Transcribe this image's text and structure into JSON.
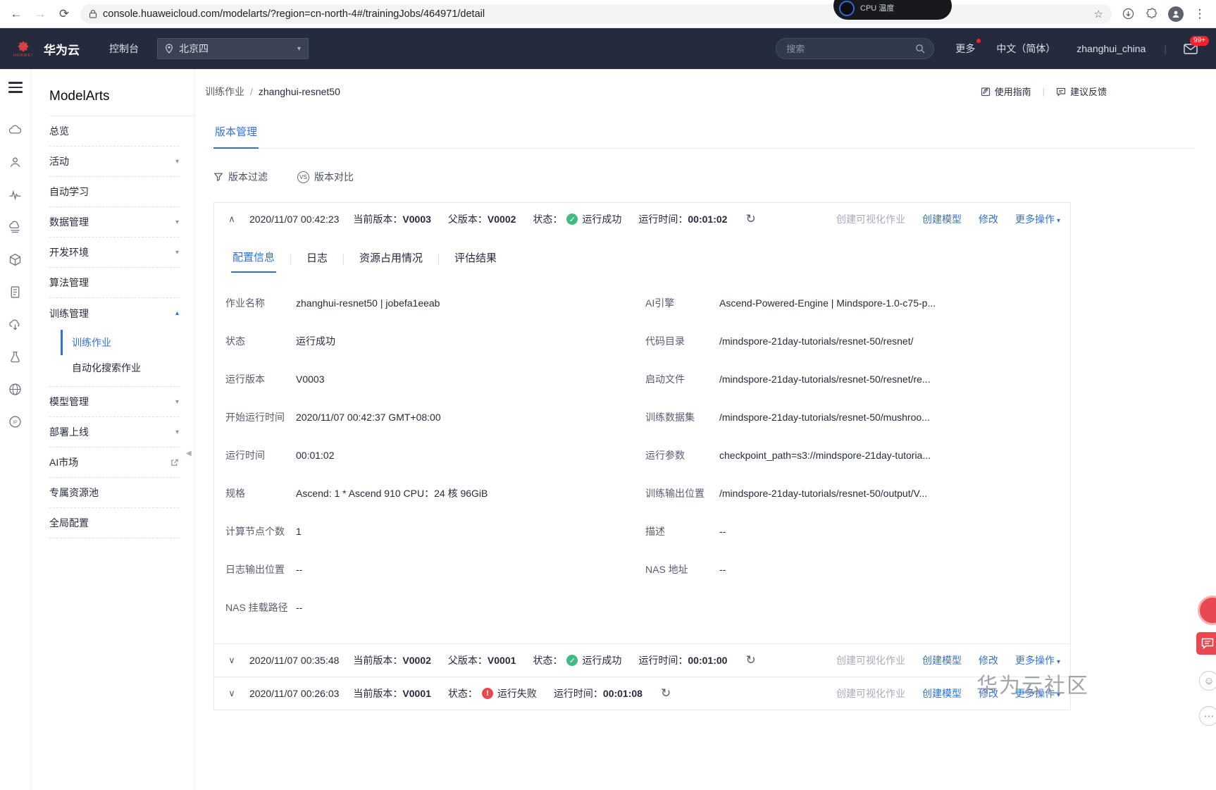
{
  "colors": {
    "accent": "#3370d4",
    "success": "#41ba83",
    "danger": "#e8484f",
    "navbar": "#232b3c"
  },
  "glyphs": {
    "back": "←",
    "forward": "→",
    "reload": "⟳",
    "star": "☆",
    "kebab": "⋮",
    "caret_down": "▾",
    "caret_up": "▴",
    "chevron_collapse": "∧",
    "chevron_expand": "∨",
    "refresh": "↻",
    "slash": "/",
    "pipe": "|",
    "success": "✓",
    "fail": "!",
    "smiley": "☺",
    "dots": "⋯",
    "sidebar_handle": "◀",
    "more_caret": "▾",
    "vs": "VS"
  },
  "browser": {
    "url": "console.huaweicloud.com/modelarts/?region=cn-north-4#/trainingJobs/464971/detail",
    "overlay_text": "CPU 温度"
  },
  "topnav": {
    "brand": "华为云",
    "logo_caption": "HUAWEI",
    "console": "控制台",
    "region": "北京四",
    "search_placeholder": "搜索",
    "more": "更多",
    "lang": "中文（简体）",
    "user": "zhanghui_china",
    "mail_badge": "99+"
  },
  "sidebar": {
    "title": "ModelArts",
    "items": [
      {
        "label": "总览"
      },
      {
        "label": "活动"
      },
      {
        "label": "自动学习"
      },
      {
        "label": "数据管理"
      },
      {
        "label": "开发环境"
      },
      {
        "label": "算法管理"
      },
      {
        "label": "训练管理",
        "children": [
          {
            "label": "训练作业"
          },
          {
            "label": "自动化搜索作业"
          }
        ]
      },
      {
        "label": "模型管理"
      },
      {
        "label": "部署上线"
      },
      {
        "label": "AI市场"
      },
      {
        "label": "专属资源池"
      },
      {
        "label": "全局配置"
      }
    ]
  },
  "page": {
    "breadcrumb_parent": "训练作业",
    "breadcrumb_current": "zhanghui-resnet50",
    "guide": "使用指南",
    "feedback": "建议反馈",
    "tab": "版本管理",
    "filter": "版本过滤",
    "compare": "版本对比"
  },
  "version_labels": {
    "current": "当前版本：",
    "parent": "父版本：",
    "status": "状态：",
    "runtime": "运行时间："
  },
  "actions": {
    "visual": "创建可视化作业",
    "create_model": "创建模型",
    "modify": "修改",
    "more": "更多操作"
  },
  "detail_tabs": [
    "配置信息",
    "日志",
    "资源占用情况",
    "评估结果"
  ],
  "versions": [
    {
      "time": "2020/11/07 00:42:23",
      "current": "V0003",
      "parent": "V0002",
      "status": "运行成功",
      "runtime": "00:01:02"
    },
    {
      "time": "2020/11/07 00:35:48",
      "current": "V0002",
      "parent": "V0001",
      "status": "运行成功",
      "runtime": "00:01:00"
    },
    {
      "time": "2020/11/07 00:26:03",
      "current": "V0001",
      "status": "运行失败",
      "runtime": "00:01:08"
    }
  ],
  "details": {
    "rows": [
      {
        "l_label": "作业名称",
        "l_value": "zhanghui-resnet50 | jobefa1eeab",
        "r_label": "AI引擎",
        "r_value": "Ascend-Powered-Engine | Mindspore-1.0-c75-p..."
      },
      {
        "l_label": "状态",
        "l_value": "运行成功",
        "r_label": "代码目录",
        "r_value": "/mindspore-21day-tutorials/resnet-50/resnet/"
      },
      {
        "l_label": "运行版本",
        "l_value": "V0003",
        "r_label": "启动文件",
        "r_value": "/mindspore-21day-tutorials/resnet-50/resnet/re..."
      },
      {
        "l_label": "开始运行时间",
        "l_value": "2020/11/07 00:42:37 GMT+08:00",
        "r_label": "训练数据集",
        "r_value": "/mindspore-21day-tutorials/resnet-50/mushroo..."
      },
      {
        "l_label": "运行时间",
        "l_value": "00:01:02",
        "r_label": "运行参数",
        "r_value": "checkpoint_path=s3://mindspore-21day-tutoria..."
      },
      {
        "l_label": "规格",
        "l_value": "Ascend: 1 * Ascend 910 CPU：24 核 96GiB",
        "r_label": "训练输出位置",
        "r_value": "/mindspore-21day-tutorials/resnet-50/output/V..."
      },
      {
        "l_label": "计算节点个数",
        "l_value": "1",
        "r_label": "描述",
        "r_value": "--"
      },
      {
        "l_label": "日志输出位置",
        "l_value": "--",
        "r_label": "NAS 地址",
        "r_value": "--"
      },
      {
        "l_label": "NAS 挂载路径",
        "l_value": "--",
        "r_label": "",
        "r_value": ""
      }
    ]
  },
  "watermark": "华为云社区"
}
